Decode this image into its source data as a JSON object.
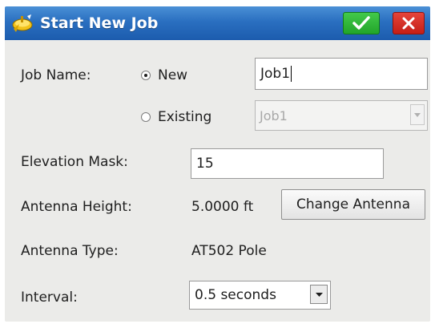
{
  "window": {
    "title": "Start New Job",
    "app_icon": "satellite-dish-icon",
    "ok_icon": "checkmark-icon",
    "close_icon": "close-icon"
  },
  "job_name": {
    "label": "Job Name:",
    "option_new": "New",
    "option_existing": "Existing",
    "selected": "New",
    "new_value": "Job1",
    "existing_value": "Job1"
  },
  "elevation_mask": {
    "label": "Elevation Mask:",
    "value": "15"
  },
  "antenna_height": {
    "label": "Antenna Height:",
    "value": "5.0000 ft",
    "change_button": "Change Antenna"
  },
  "antenna_type": {
    "label": "Antenna Type:",
    "value": "AT502 Pole"
  },
  "interval": {
    "label": "Interval:",
    "value": "0.5 seconds"
  },
  "colors": {
    "titlebar": "#2a6fc0",
    "ok_button": "#22a52a",
    "close_button": "#c41f17",
    "window_bg": "#ebebe9"
  }
}
